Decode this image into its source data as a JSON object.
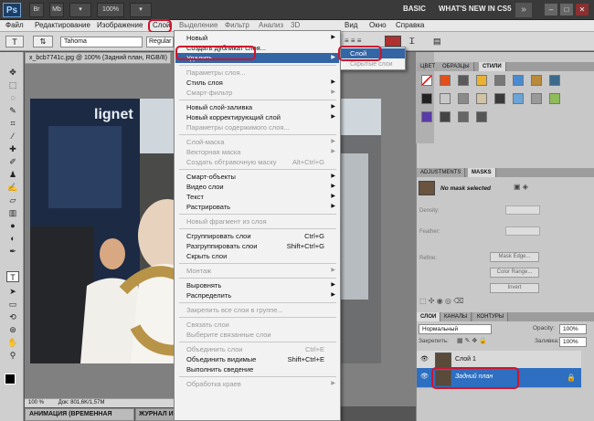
{
  "appbar": {
    "logo": "Ps",
    "buttons": [
      "Br",
      "Mb",
      "▾",
      "100%",
      "▾"
    ],
    "workspace_basic": "BASIC",
    "workspace_new": "WHAT'S NEW IN CS5",
    "arrow": "»",
    "window_controls": [
      "–",
      "□",
      "✕"
    ]
  },
  "menubar": {
    "items": [
      "Файл",
      "Редактирование",
      "Изображение",
      "Слой",
      "Выделение",
      "Фильтр",
      "Анализ",
      "3D",
      "Вид",
      "Окно",
      "Справка"
    ]
  },
  "options": {
    "font_family": "Tahoma",
    "font_style": "Regular"
  },
  "document": {
    "tab_title": "x_bcb7741c.jpg @ 100% (Задний план, RGB/8)",
    "zoom": "100 %",
    "status": "Док: 801,6K/1,57M",
    "photo_sign": "lignet"
  },
  "bottom_tabs": {
    "animation": "АНИМАЦИЯ (ВРЕМЕННАЯ ШКАЛА)",
    "journal": "ЖУРНАЛ ИЗ"
  },
  "layer_menu": {
    "items": [
      {
        "label": "Новый",
        "arrow": true
      },
      {
        "label": "Создать дубликат слоя..."
      },
      {
        "label": "Удалить",
        "arrow": true,
        "highlight": true
      },
      {
        "sep": true
      },
      {
        "label": "Параметры слоя...",
        "disabled": true
      },
      {
        "label": "Стиль слоя",
        "arrow": true
      },
      {
        "label": "Смарт-фильтр",
        "arrow": true,
        "disabled": true
      },
      {
        "sep": true
      },
      {
        "label": "Новый слой-заливка",
        "arrow": true
      },
      {
        "label": "Новый корректирующий слой",
        "arrow": true
      },
      {
        "label": "Параметры содержимого слоя...",
        "disabled": true
      },
      {
        "sep": true
      },
      {
        "label": "Слой-маска",
        "arrow": true,
        "disabled": true
      },
      {
        "label": "Векторная маска",
        "arrow": true,
        "disabled": true
      },
      {
        "label": "Создать обтравочную маску",
        "shortcut": "Alt+Ctrl+G",
        "disabled": true
      },
      {
        "sep": true
      },
      {
        "label": "Смарт-объекты",
        "arrow": true
      },
      {
        "label": "Видео слои",
        "arrow": true
      },
      {
        "label": "Текст",
        "arrow": true
      },
      {
        "label": "Растрировать",
        "arrow": true
      },
      {
        "sep": true
      },
      {
        "label": "Новый фрагмент из слоя",
        "disabled": true
      },
      {
        "sep": true
      },
      {
        "label": "Сгруппировать слои",
        "shortcut": "Ctrl+G"
      },
      {
        "label": "Разгруппировать слои",
        "shortcut": "Shift+Ctrl+G"
      },
      {
        "label": "Скрыть слои"
      },
      {
        "sep": true
      },
      {
        "label": "Монтаж",
        "arrow": true,
        "disabled": true
      },
      {
        "sep": true
      },
      {
        "label": "Выровнять",
        "arrow": true
      },
      {
        "label": "Распределить",
        "arrow": true
      },
      {
        "sep": true
      },
      {
        "label": "Закрепить все слои в группе...",
        "disabled": true
      },
      {
        "sep": true
      },
      {
        "label": "Связать слои",
        "disabled": true
      },
      {
        "label": "Выберите связанные слои",
        "disabled": true
      },
      {
        "sep": true
      },
      {
        "label": "Объединить слои",
        "shortcut": "Ctrl+E",
        "disabled": true
      },
      {
        "label": "Объединить видимые",
        "shortcut": "Shift+Ctrl+E"
      },
      {
        "label": "Выполнить сведение"
      },
      {
        "sep": true
      },
      {
        "label": "Обработка краев",
        "arrow": true,
        "disabled": true
      }
    ]
  },
  "delete_submenu": {
    "layer": "Слой",
    "hidden": "Скрытые слои"
  },
  "panels": {
    "tabs_top": [
      "ЦВЕТ",
      "ОБРАЗЦЫ",
      "СТИЛИ"
    ],
    "tabs_adj": [
      "ADJUSTMENTS",
      "MASKS"
    ],
    "mask_status": "No mask selected",
    "density": "Density:",
    "feather": "Feather:",
    "refine": "Refine:",
    "mask_edge": "Mask Edge...",
    "color_range": "Color Range...",
    "invert": "Invert",
    "tabs_layers": [
      "СЛОИ",
      "КАНАЛЫ",
      "КОНТУРЫ"
    ],
    "blend_mode": "Нормальный",
    "opacity_label": "Opacity:",
    "opacity": "100%",
    "lock_label": "Закрепить:",
    "fill_label": "Заливка:",
    "fill": "100%",
    "layers": [
      "Слой 1",
      "Задний план"
    ]
  },
  "colors": {
    "highlight": "#3465a4",
    "annotation": "#d0142c"
  }
}
